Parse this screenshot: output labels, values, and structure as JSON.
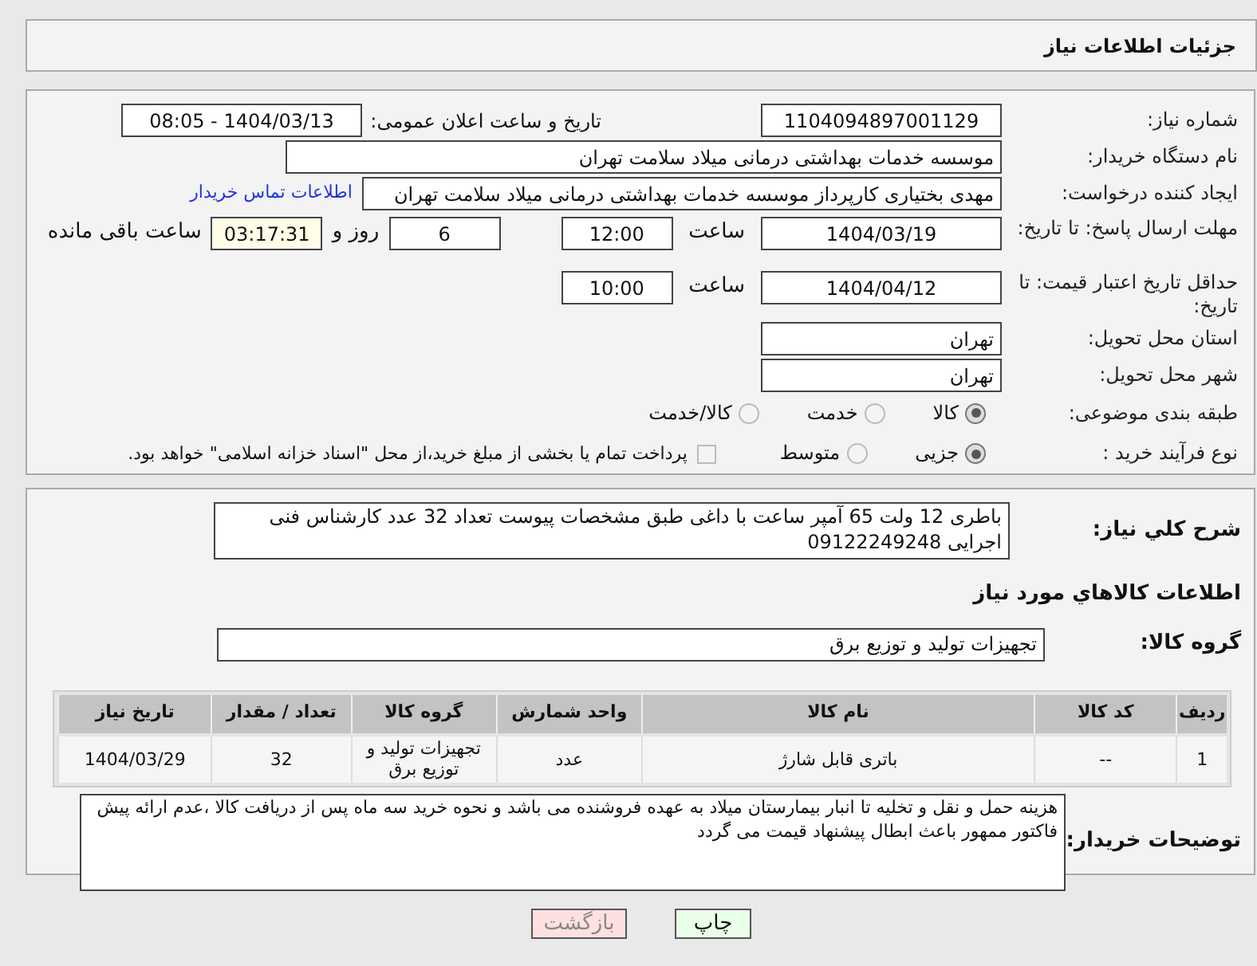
{
  "header": {
    "title": "جزئیات اطلاعات نیاز"
  },
  "need_number": {
    "label": "شماره نیاز:",
    "value": "1104094897001129"
  },
  "announce": {
    "label": "تاریخ و ساعت اعلان عمومی:",
    "value": "1404/03/13 - 08:05"
  },
  "buyer_org": {
    "label": "نام دستگاه خریدار:",
    "value": "موسسه خدمات بهداشتی درمانی میلاد سلامت تهران"
  },
  "requester": {
    "label": "ایجاد کننده درخواست:",
    "value": "مهدی بختیاری کارپرداز موسسه خدمات بهداشتی درمانی میلاد سلامت تهران",
    "link": "اطلاعات تماس خریدار"
  },
  "deadline": {
    "label": "مهلت ارسال پاسخ: تا تاریخ:",
    "date": "1404/03/19",
    "time_label": "ساعت",
    "time": "12:00",
    "days": "6",
    "days_label": "روز و",
    "remaining": "03:17:31",
    "remaining_label": "ساعت باقی مانده"
  },
  "validity": {
    "label": "حداقل تاریخ اعتبار قیمت: تا تاریخ:",
    "date": "1404/04/12",
    "time_label": "ساعت",
    "time": "10:00"
  },
  "province": {
    "label": "استان محل تحویل:",
    "value": "تهران"
  },
  "city": {
    "label": "شهر محل تحویل:",
    "value": "تهران"
  },
  "category": {
    "label": "طبقه بندی موضوعی:",
    "options": [
      {
        "label": "کالا",
        "selected": true
      },
      {
        "label": "خدمت",
        "selected": false
      },
      {
        "label": "کالا/خدمت",
        "selected": false
      }
    ]
  },
  "process": {
    "label": "نوع فرآیند خرید :",
    "options": [
      {
        "label": "جزیی",
        "selected": true
      },
      {
        "label": "متوسط",
        "selected": false
      }
    ],
    "payment": {
      "label": "پرداخت تمام یا بخشی از مبلغ خرید،از محل \"اسناد خزانه اسلامی\" خواهد بود.",
      "checked": false
    }
  },
  "description": {
    "label": "شرح کلي نياز:",
    "value": "باطری 12 ولت 65 آمپر ساعت با داغی طبق مشخصات پیوست تعداد 32 عدد کارشناس فنی اجرایی 09122249248"
  },
  "goods_heading": "اطلاعات کالاهاي مورد نياز",
  "group": {
    "label": "گروه کالا:",
    "value": "تجهیزات تولید و توزیع برق"
  },
  "table": {
    "columns": [
      "ردیف",
      "کد کالا",
      "نام کالا",
      "واحد شمارش",
      "گروه کالا",
      "تعداد / مقدار",
      "تاریخ نیاز"
    ],
    "rows": [
      [
        "1",
        "--",
        "باتری قابل شارژ",
        "عدد",
        "تجهیزات تولید و توزیع برق",
        "32",
        "1404/03/29"
      ]
    ]
  },
  "notes": {
    "label": "توضیحات خریدار:",
    "value": "هزینه حمل و نقل و تخلیه تا انبار بیمارستان میلاد به عهده فروشنده می باشد و نحوه خرید سه ماه پس از دریافت کالا ،عدم ارائه پیش فاکتور ممهور باعث ابطال پیشنهاد قیمت می گردد"
  },
  "buttons": [
    {
      "label": "چاپ",
      "kind": "print"
    },
    {
      "label": "بازگشت",
      "kind": "back"
    }
  ]
}
